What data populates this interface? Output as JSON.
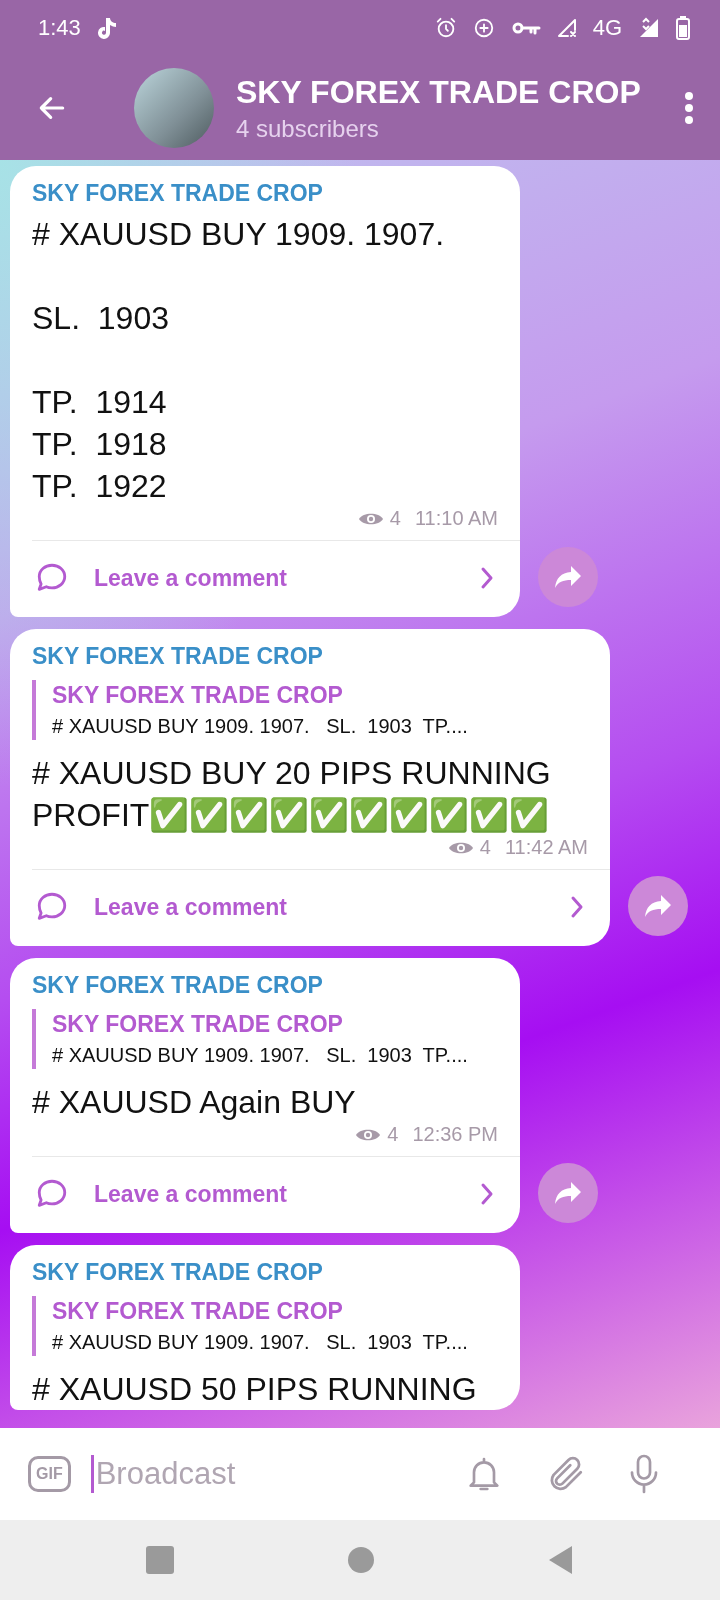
{
  "status_bar": {
    "time": "1:43",
    "network": "4G"
  },
  "header": {
    "title": "SKY FOREX TRADE CROP",
    "subtitle": "4 subscribers"
  },
  "messages": [
    {
      "author": "SKY FOREX TRADE CROP",
      "body": "# XAUUSD BUY 1909. 1907.\n\nSL.  1903\n\nTP.  1914\nTP.  1918\nTP.  1922",
      "views": "4",
      "time": "11:10 AM",
      "comment_label": "Leave a comment"
    },
    {
      "author": "SKY FOREX TRADE CROP",
      "reply": {
        "author": "SKY FOREX TRADE CROP",
        "text": "# XAUUSD BUY 1909. 1907.   SL.  1903  TP...."
      },
      "body": "# XAUUSD BUY 20 PIPS RUNNING PROFIT✅✅✅✅✅✅✅✅✅✅",
      "views": "4",
      "time": "11:42 AM",
      "comment_label": "Leave a comment"
    },
    {
      "author": "SKY FOREX TRADE CROP",
      "reply": {
        "author": "SKY FOREX TRADE CROP",
        "text": "# XAUUSD BUY 1909. 1907.   SL.  1903  TP...."
      },
      "body": "# XAUUSD Again BUY",
      "views": "4",
      "time": "12:36 PM",
      "comment_label": "Leave a comment"
    },
    {
      "author": "SKY FOREX TRADE CROP",
      "reply": {
        "author": "SKY FOREX TRADE CROP",
        "text": "# XAUUSD BUY 1909. 1907.   SL.  1903  TP...."
      },
      "body": "# XAUUSD 50 PIPS RUNNING"
    }
  ],
  "composer": {
    "gif_label": "GIF",
    "placeholder": "Broadcast"
  }
}
